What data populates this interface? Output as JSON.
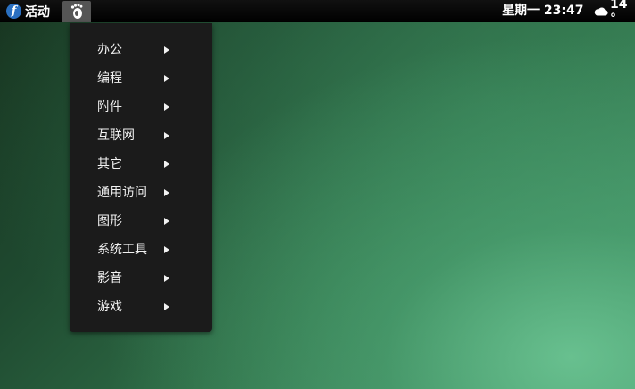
{
  "topbar": {
    "activities_label": "活动",
    "clock": "星期一 23:47",
    "temperature": "14 °"
  },
  "icons": {
    "activities": "fedora-logo-icon",
    "app_menu": "gnome-foot-icon",
    "weather": "cloud-icon",
    "submenu": "triangle-right-icon"
  },
  "menu": {
    "items": [
      {
        "label": "办公"
      },
      {
        "label": "编程"
      },
      {
        "label": "附件"
      },
      {
        "label": "互联网"
      },
      {
        "label": "其它"
      },
      {
        "label": "通用访问"
      },
      {
        "label": "图形"
      },
      {
        "label": "系统工具"
      },
      {
        "label": "影音"
      },
      {
        "label": "游戏"
      }
    ]
  },
  "colors": {
    "topbar": "#000000",
    "menu_background": "#1b1b1b",
    "menu_text": "#f2f2f2",
    "fedora_blue": "#2a6fc1"
  }
}
